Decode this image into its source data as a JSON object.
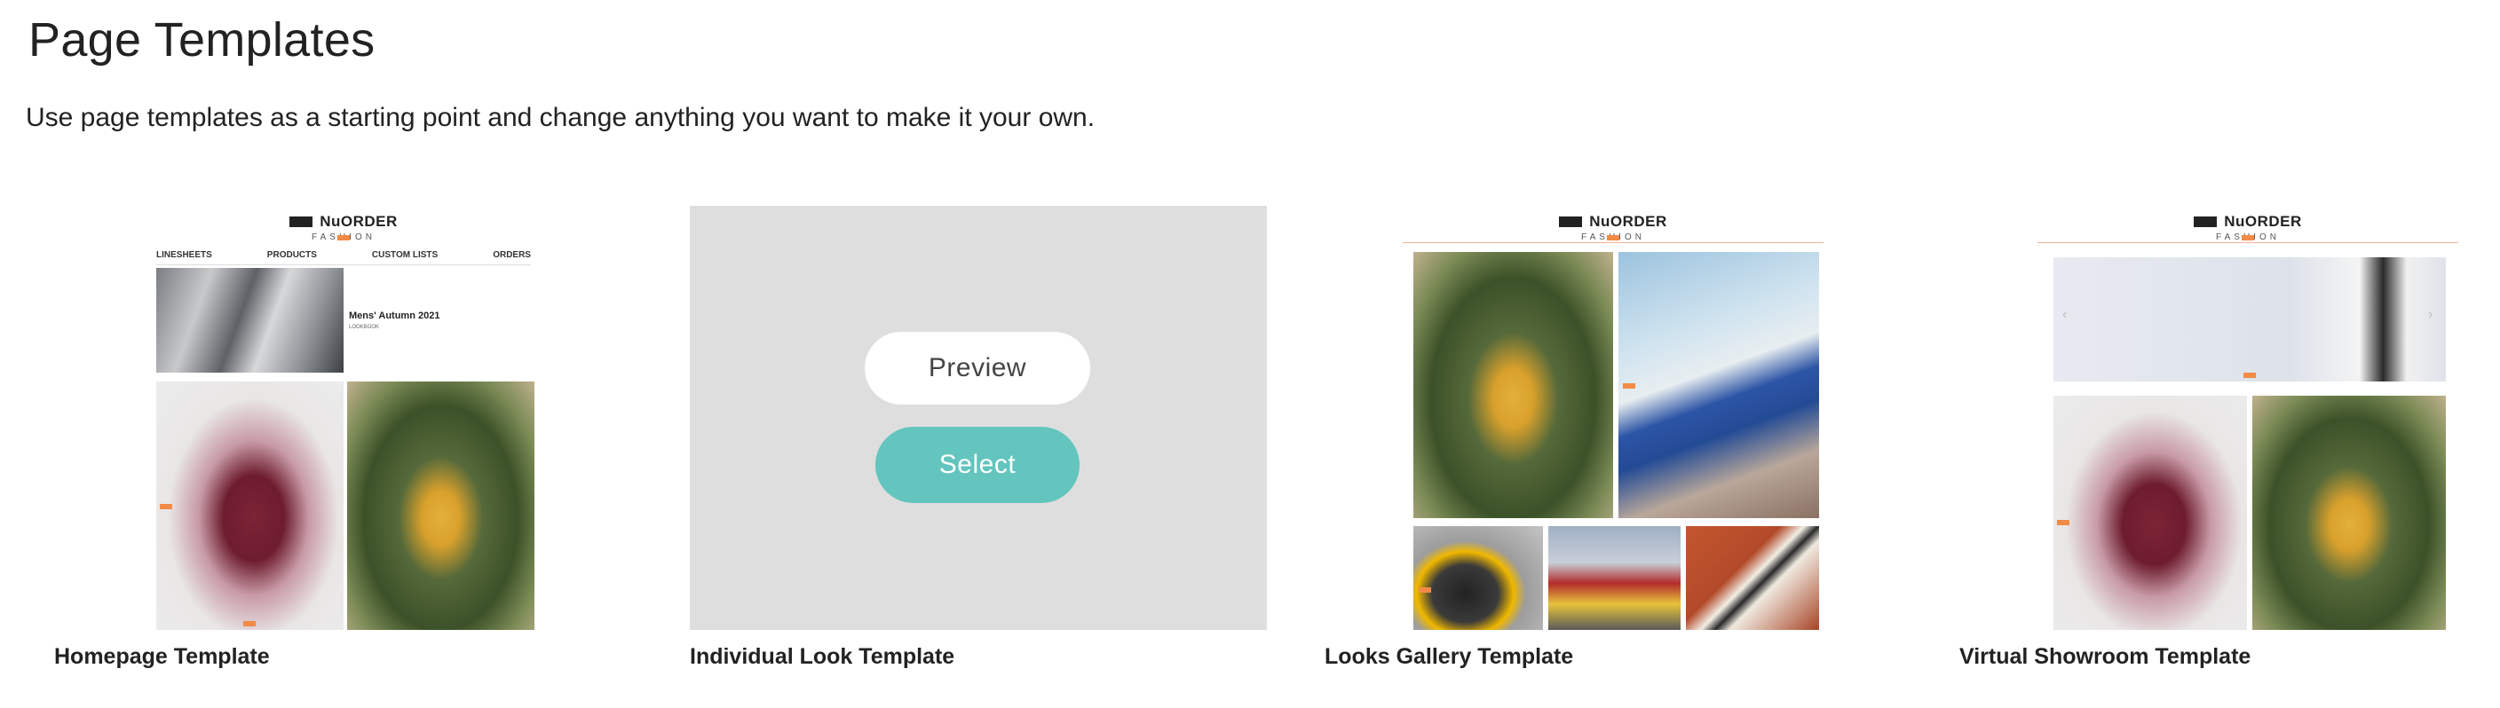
{
  "header": {
    "title": "Page Templates",
    "description": "Use page templates as a starting point and change anything you want to make it your own."
  },
  "templates": [
    {
      "label": "Homepage Template",
      "preview": {
        "brand": "NuORDER",
        "brand_sub": "FASHION",
        "nav": [
          "LINESHEETS",
          "PRODUCTS",
          "CUSTOM LISTS",
          "ORDERS"
        ],
        "feature_title": "Mens' Autumn 2021",
        "feature_sub": "LOOKBOOK"
      }
    },
    {
      "label": "Individual Look Template",
      "actions": {
        "preview": "Preview",
        "select": "Select"
      }
    },
    {
      "label": "Looks Gallery Template",
      "preview": {
        "brand": "NuORDER",
        "brand_sub": "FASHION"
      }
    },
    {
      "label": "Virtual Showroom Template",
      "preview": {
        "brand": "NuORDER",
        "brand_sub": "FASHION"
      }
    }
  ],
  "colors": {
    "select_button": "#63c5bd",
    "overlay": "#dedede",
    "accent_tag": "#f28b45"
  }
}
